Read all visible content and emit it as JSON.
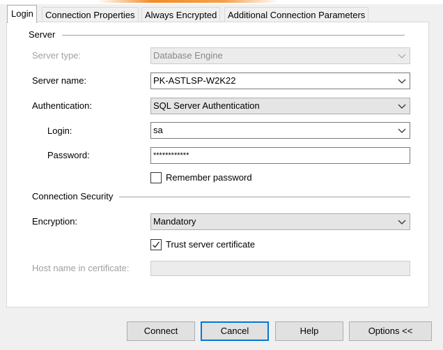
{
  "tabs": [
    {
      "label": "Login"
    },
    {
      "label": "Connection Properties"
    },
    {
      "label": "Always Encrypted"
    },
    {
      "label": "Additional Connection Parameters"
    }
  ],
  "server_section": {
    "title": "Server",
    "server_type": {
      "label": "Server type:",
      "value": "Database Engine"
    },
    "server_name": {
      "label": "Server name:",
      "value": "PK-ASTLSP-W2K22"
    },
    "authentication": {
      "label": "Authentication:",
      "value": "SQL Server Authentication"
    },
    "login": {
      "label": "Login:",
      "value": "sa"
    },
    "password": {
      "label": "Password:",
      "value": "************"
    },
    "remember_password": {
      "label": "Remember password",
      "checked": false
    }
  },
  "security_section": {
    "title": "Connection Security",
    "encryption": {
      "label": "Encryption:",
      "value": "Mandatory"
    },
    "trust_certificate": {
      "label": "Trust server certificate",
      "checked": true
    },
    "host_name": {
      "label": "Host name in certificate:",
      "value": ""
    }
  },
  "buttons": {
    "connect": "Connect",
    "cancel": "Cancel",
    "help": "Help",
    "options": "Options <<"
  },
  "colors": {
    "default_button_border": "#0078d7",
    "banner_accent": "#f28c28"
  },
  "icons": [
    "chevron-down-icon",
    "checkmark-icon"
  ]
}
